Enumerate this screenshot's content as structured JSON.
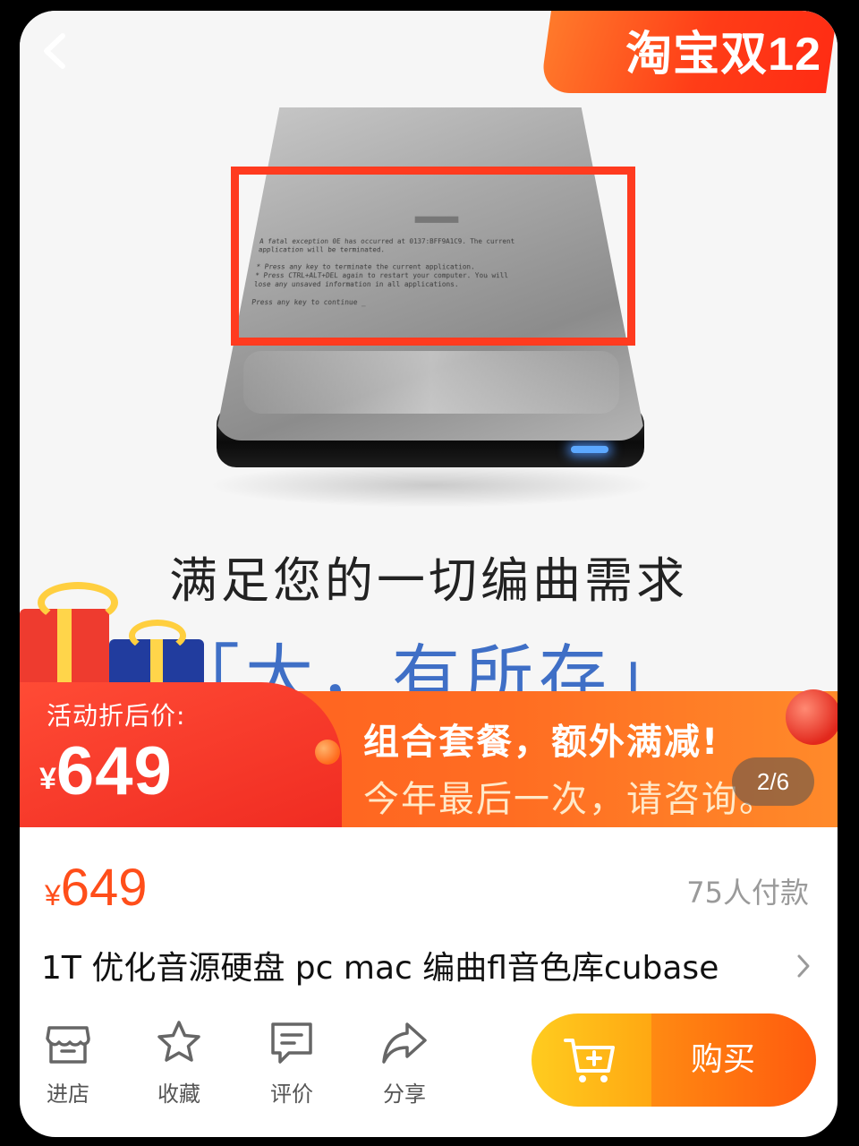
{
  "promo_banner": {
    "text": "淘宝双12"
  },
  "product_image": {
    "error_screen": "A fatal exception 0E has occurred at 0137:BFF9A1C9. The current\napplication will be terminated.\n\n*  Press any key to terminate the current application.\n*  Press CTRL+ALT+DEL again to restart your computer. You will\n   lose any unsaved information in all applications.\n\n             Press any key to continue _",
    "slogan": "满足您的一切编曲需求",
    "slogan_2": "「大，有所存」"
  },
  "activity": {
    "label": "活动折后价:",
    "currency": "¥",
    "price": "649",
    "combo_line_1": "组合套餐，额外满减!",
    "combo_line_2": "今年最后一次，请咨询。"
  },
  "gallery": {
    "indicator": "2/6"
  },
  "product": {
    "currency": "¥",
    "price": "649",
    "sold": "75人付款",
    "title": "1T 优化音源硬盘 pc mac 编曲fl音色库cubase"
  },
  "bottom_bar": {
    "store_label": "进店",
    "favorite_label": "收藏",
    "review_label": "评价",
    "share_label": "分享",
    "buy_label": "购买"
  },
  "colors": {
    "accent": "#ff4e1a",
    "buy_button": "#ff6a10",
    "cart_button": "#ffb816",
    "highlight_box": "#ff3b1f"
  }
}
